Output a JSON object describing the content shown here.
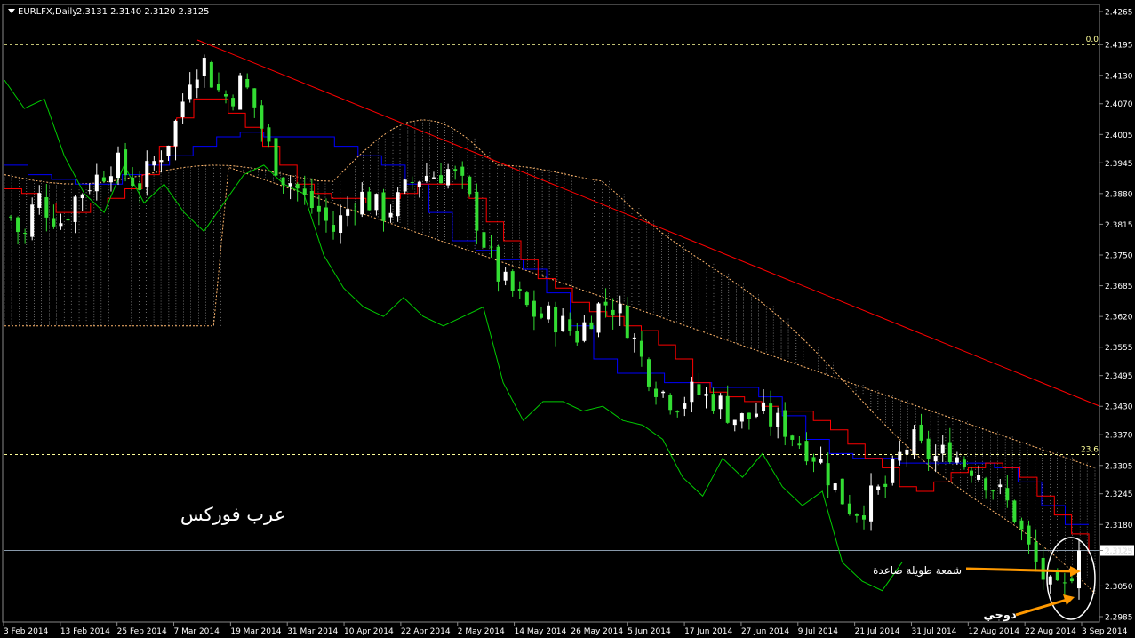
{
  "header": {
    "symbol": "EURLFX,Daily",
    "ohlc": "2.3131 2.3140 2.3120 2.3125"
  },
  "watermark": "عرب فوركس",
  "annotations": {
    "long_candle": "شمعة طويلة صاعدة",
    "doji": "دوجي"
  },
  "fib_levels": [
    {
      "label": "0.0",
      "price": 2.4195
    },
    {
      "label": "23.6",
      "price": 2.3328
    }
  ],
  "current_price_label": "2.3125",
  "colors": {
    "background": "#000000",
    "bull_candle": "#ffffff",
    "bear_candle": "#33dd33",
    "kijun": "#0000ff",
    "tenkan": "#ff0000",
    "chikou": "#00cc00",
    "cloud": "#ffb66c",
    "trendline": "#ff0000",
    "fib": "#ffff99",
    "arrow": "#ff9900",
    "text": "#ffffff"
  },
  "chart_data": {
    "type": "candlestick",
    "ylim": [
      2.2985,
      2.4265
    ],
    "yticks": [
      "2.4265",
      "2.4195",
      "2.4130",
      "2.4070",
      "2.4005",
      "2.3945",
      "2.3880",
      "2.3815",
      "2.3750",
      "2.3685",
      "2.3620",
      "2.3555",
      "2.3495",
      "2.3430",
      "2.3370",
      "2.3305",
      "2.3245",
      "2.3180",
      "2.3125",
      "2.3050",
      "2.2985"
    ],
    "xticks": [
      "3 Feb 2014",
      "13 Feb 2014",
      "25 Feb 2014",
      "7 Mar 2014",
      "19 Mar 2014",
      "31 Mar 2014",
      "10 Apr 2014",
      "22 Apr 2014",
      "2 May 2014",
      "14 May 2014",
      "26 May 2014",
      "5 Jun 2014",
      "17 Jun 2014",
      "27 Jun 2014",
      "9 Jul 2014",
      "21 Jul 2014",
      "31 Jul 2014",
      "12 Aug 2014",
      "22 Aug 2014",
      "3 Sep 2014"
    ],
    "close_path": [
      2.383,
      2.378,
      2.388,
      2.384,
      2.382,
      2.387,
      2.39,
      2.392,
      2.395,
      2.392,
      2.39,
      2.394,
      2.398,
      2.404,
      2.414,
      2.416,
      2.41,
      2.408,
      2.412,
      2.406,
      2.398,
      2.392,
      2.39,
      2.386,
      2.384,
      2.38,
      2.384,
      2.388,
      2.386,
      2.384,
      2.386,
      2.39,
      2.392,
      2.392,
      2.393,
      2.39,
      2.384,
      2.376,
      2.37,
      2.367,
      2.364,
      2.362,
      2.362,
      2.36,
      2.358,
      2.362,
      2.365,
      2.364,
      2.36,
      2.353,
      2.348,
      2.345,
      2.344,
      2.346,
      2.345,
      2.344,
      2.341,
      2.34,
      2.342,
      2.34,
      2.339,
      2.336,
      2.334,
      2.331,
      2.326,
      2.322,
      2.321,
      2.324,
      2.326,
      2.332,
      2.336,
      2.333,
      2.332,
      2.334,
      2.331,
      2.33,
      2.327,
      2.324,
      2.32,
      2.313,
      2.308,
      2.303,
      2.304,
      2.3125
    ],
    "series": [
      {
        "name": "Tenkan-sen",
        "values": [
          2.389,
          2.388,
          2.386,
          2.384,
          2.384,
          2.386,
          2.387,
          2.389,
          2.392,
          2.398,
          2.404,
          2.408,
          2.408,
          2.405,
          2.402,
          2.398,
          2.394,
          2.39,
          2.388,
          2.387,
          2.387,
          2.386,
          2.387,
          2.388,
          2.39,
          2.39,
          2.39,
          2.387,
          2.382,
          2.378,
          2.374,
          2.37,
          2.368,
          2.365,
          2.363,
          2.362,
          2.36,
          2.359,
          2.356,
          2.353,
          2.348,
          2.346,
          2.345,
          2.344,
          2.343,
          2.342,
          2.342,
          2.34,
          2.338,
          2.335,
          2.332,
          2.33,
          2.326,
          2.325,
          2.327,
          2.329,
          2.33,
          2.331,
          2.33,
          2.328,
          2.324,
          2.32,
          2.316,
          2.312
        ]
      },
      {
        "name": "Kijun-sen",
        "values": [
          2.394,
          2.392,
          2.391,
          2.39,
          2.39,
          2.392,
          2.394,
          2.396,
          2.398,
          2.4,
          2.401,
          2.4,
          2.4,
          2.4,
          2.398,
          2.396,
          2.394,
          2.39,
          2.384,
          2.378,
          2.376,
          2.374,
          2.372,
          2.367,
          2.36,
          2.353,
          2.35,
          2.35,
          2.348,
          2.348,
          2.347,
          2.347,
          2.345,
          2.341,
          2.336,
          2.333,
          2.332,
          2.332,
          2.331,
          2.331,
          2.331,
          2.331,
          2.33,
          2.327,
          2.322,
          2.318,
          2.318
        ]
      },
      {
        "name": "Chikou Span",
        "values": [
          2.412,
          2.406,
          2.408,
          2.396,
          2.388,
          2.384,
          2.394,
          2.386,
          2.39,
          2.384,
          2.38,
          2.386,
          2.392,
          2.394,
          2.39,
          2.388,
          2.375,
          2.368,
          2.364,
          2.362,
          2.366,
          2.362,
          2.36,
          2.362,
          2.364,
          2.348,
          2.34,
          2.344,
          2.344,
          2.342,
          2.343,
          2.34,
          2.339,
          2.336,
          2.328,
          2.324,
          2.332,
          2.328,
          2.333,
          2.326,
          2.322,
          2.325,
          2.31,
          2.306,
          2.304,
          2.31
        ]
      }
    ]
  }
}
